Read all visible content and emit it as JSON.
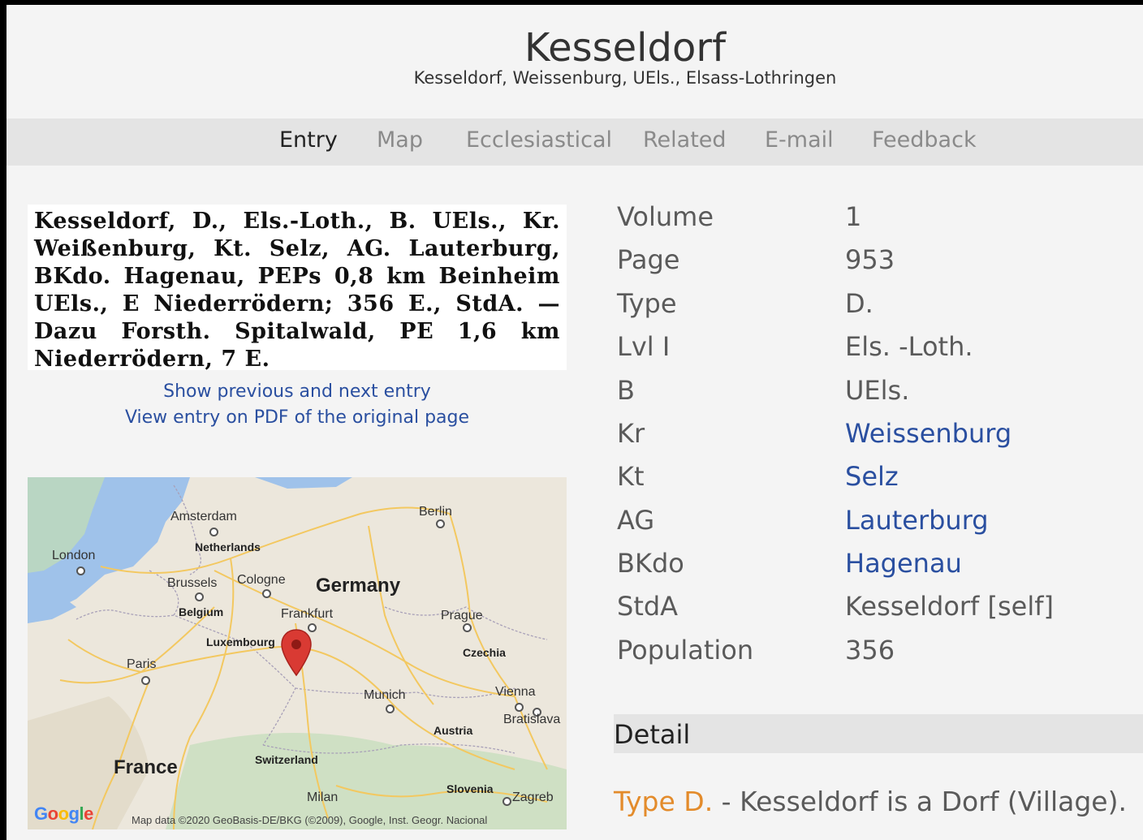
{
  "header": {
    "title": "Kesseldorf",
    "subtitle": "Kesseldorf, Weissenburg, UEls., Elsass-Lothringen"
  },
  "nav": {
    "tabs": [
      "Entry",
      "Map",
      "Ecclesiastical",
      "Related",
      "E-mail",
      "Feedback"
    ],
    "active": "Entry"
  },
  "entry": {
    "snippet_text": "Kesseldorf, D., Els.-Loth., B. UEls., Kr. Weißenburg, Kt. Selz, AG. Lauterburg, BKdo. Hagenau, PEPs 0,8 km Beinheim UEls., E Niederrödern; 356 E., StdA. — Dazu Forsth. Spitalwald, PE 1,6 km Niederrödern, 7 E.",
    "link_prev_next": "Show previous and next entry",
    "link_pdf": "View entry on PDF of the original page"
  },
  "map": {
    "labels": {
      "amsterdam": "Amsterdam",
      "berlin": "Berlin",
      "london": "London",
      "netherlands": "Netherlands",
      "brussels": "Brussels",
      "cologne": "Cologne",
      "germany": "Germany",
      "belgium": "Belgium",
      "frankfurt": "Frankfurt",
      "prague": "Prague",
      "luxembourg": "Luxembourg",
      "czechia": "Czechia",
      "paris": "Paris",
      "munich": "Munich",
      "vienna": "Vienna",
      "bratislava": "Bratislava",
      "austria": "Austria",
      "france": "France",
      "switzerland": "Switzerland",
      "slovenia": "Slovenia",
      "zagreb": "Zagreb",
      "milan": "Milan"
    },
    "logo": "Google",
    "attribution": "Map data ©2020 GeoBasis-DE/BKG (©2009), Google, Inst. Geogr. Nacional",
    "marker_color": "#d93a33"
  },
  "info_rows": [
    {
      "key": "Volume",
      "value": "1",
      "link": false
    },
    {
      "key": "Page",
      "value": "953",
      "link": false
    },
    {
      "key": "Type",
      "value": "D.",
      "link": false
    },
    {
      "key": "Lvl I",
      "value": "Els. -Loth.",
      "link": false
    },
    {
      "key": "B",
      "value": "UEls.",
      "link": false
    },
    {
      "key": "Kr",
      "value": "Weissenburg",
      "link": true
    },
    {
      "key": "Kt",
      "value": "Selz",
      "link": true
    },
    {
      "key": "AG",
      "value": "Lauterburg",
      "link": true
    },
    {
      "key": "BKdo",
      "value": "Hagenau",
      "link": true
    },
    {
      "key": "StdA",
      "value": "Kesseldorf [self]",
      "link": false
    },
    {
      "key": "Population",
      "value": "356",
      "link": false
    }
  ],
  "detail": {
    "heading": "Detail",
    "type_label": "Type D.",
    "text": " - Kesseldorf is a Dorf (Village)."
  },
  "colors": {
    "link": "#2a4fa0",
    "accent_orange": "#e38b2b",
    "nav_bar": "#e4e4e4"
  }
}
